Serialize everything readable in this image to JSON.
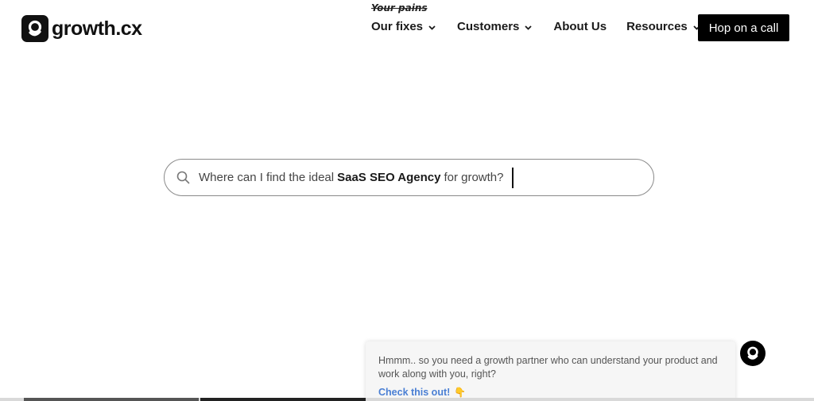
{
  "brand": {
    "name": "growth.cx"
  },
  "nav": {
    "fixes_note": "Your pains",
    "fixes_label": "Our fixes",
    "customers_label": "Customers",
    "about_label": "About Us",
    "resources_label": "Resources",
    "cta_label": "Hop on a call"
  },
  "search": {
    "prefix": "Where can I find the ideal",
    "highlight": "SaaS SEO Agency",
    "suffix": "for growth?"
  },
  "chat": {
    "message": "Hmmm.. so you need a growth partner who can understand your product and work along with you, right?",
    "link_label": "Check this out!",
    "link_emoji": "👇"
  },
  "icons": {
    "search": "search-icon",
    "chevron": "chevron-down-icon",
    "logo": "growth-logo-icon"
  },
  "colors": {
    "cta_bg": "#000000",
    "link": "#4a7fd4"
  }
}
